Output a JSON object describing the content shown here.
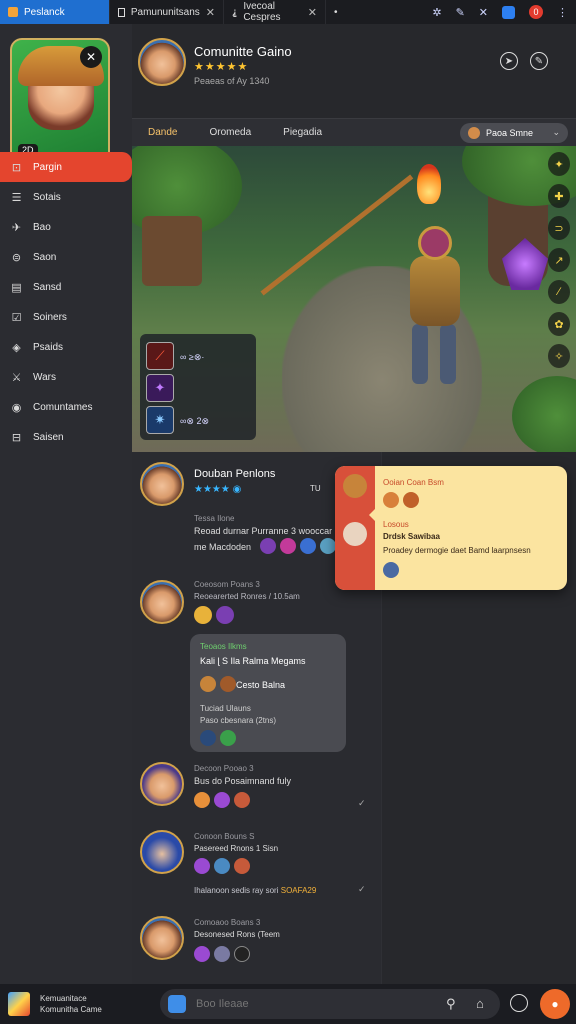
{
  "tabs": [
    {
      "label": "Peslanck",
      "active": true
    },
    {
      "label": "Pamununitsans"
    },
    {
      "label": "Ivecoal Cespres"
    }
  ],
  "topbar_icons": [
    "bug-icon",
    "pen-icon",
    "x-icon",
    "window-icon",
    "notification-badge"
  ],
  "notification_count": "0",
  "sidebar": {
    "logo_badge": "✕",
    "logo_level": "2D",
    "items": [
      {
        "label": "Pargin",
        "icon": "login-icon",
        "active": true
      },
      {
        "label": "Sotais",
        "icon": "list-icon"
      },
      {
        "label": "Bao",
        "icon": "pin-icon"
      },
      {
        "label": "Saon",
        "icon": "car-icon"
      },
      {
        "label": "Sansd",
        "icon": "document-icon"
      },
      {
        "label": "Soiners",
        "icon": "check-icon"
      },
      {
        "label": "Psaids",
        "icon": "bolt-icon"
      },
      {
        "label": "Wars",
        "icon": "sword-icon"
      },
      {
        "label": "Comuntames",
        "icon": "chat-icon"
      },
      {
        "label": "Saisen",
        "icon": "settings-icon"
      }
    ]
  },
  "profile": {
    "title": "Comunitte Gaino",
    "stars": "★★★★★",
    "subtitle": "Peaeas of Ay 1340"
  },
  "content_tabs": [
    {
      "label": "Dande",
      "active": true
    },
    {
      "label": "Oromeda"
    },
    {
      "label": "Piegadia"
    }
  ],
  "select": {
    "label": "Paoa Smne"
  },
  "hero": {
    "skill_lines": [
      "∞ ≥⊗·",
      "",
      "∞⊗  2⊗"
    ],
    "side_icons": [
      "✦",
      "✚",
      "⊃",
      "↗",
      "∕",
      "✿",
      "✧"
    ]
  },
  "posts": [
    {
      "name": "Douban Penlons",
      "stars": "★★★★ ◉",
      "tag": "TU",
      "meta": "Tessa Ilone",
      "line1": "Reoad durnar Purranne 3 wooccar",
      "line2": "me Macdoden"
    },
    {
      "meta": "Coeosom Poans 3",
      "line1": "Reoearerted Ronres / 10.5am",
      "card": {
        "tag": "Teoaos Ilkms",
        "line1": "Kali ɭ  S  Ila Ralma Megams",
        "line2": "Cesto Balna",
        "sub": "Tuciad Ulauns",
        "line3": "Paso cbesnara (2tns)"
      }
    },
    {
      "meta": "Decoon Pooao 3",
      "line1": "Bus do Posaimnand fuly"
    },
    {
      "meta": "Conoon Bouns S",
      "line1": "Pasereed Rnons 1 Sisn",
      "line2": "Ihalanoon sedis ray sori",
      "line2_highlight": "SOAFA29"
    },
    {
      "meta": "Comoaoo Boans 3",
      "line1": "Desonesed Rons (Teem"
    }
  ],
  "popup": {
    "line1": "Ooian Coan Bsm",
    "line2": "Losous",
    "line3": "Drdsk Sawibaa",
    "line4": "Proadey dermogie daet Bamd laarpnsesn"
  },
  "bottom": {
    "brand_line1": "Kemuanitace",
    "brand_line2": "Komunitha Came",
    "search_placeholder": "Boo Ileaae",
    "icons": [
      "search-icon",
      "bag-icon",
      "globe-icon",
      "game-fab-icon"
    ]
  }
}
